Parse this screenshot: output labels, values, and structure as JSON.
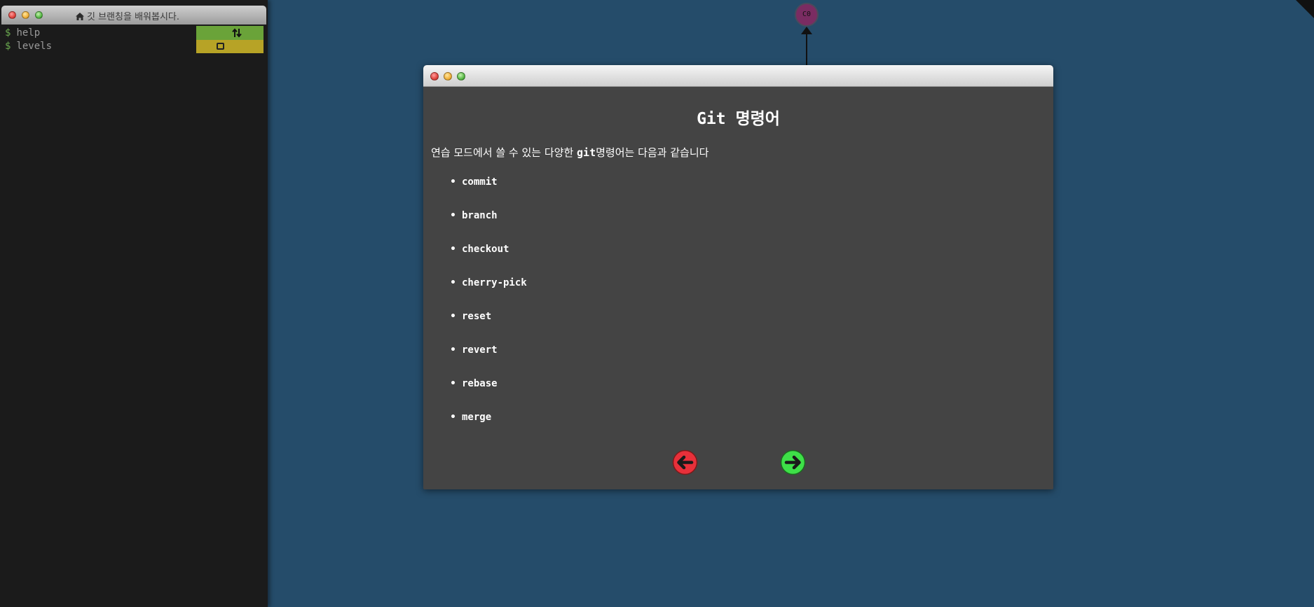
{
  "terminal": {
    "title": "깃 브랜칭을 배워봅시다.",
    "home_icon": "home-icon",
    "lines": [
      {
        "prompt": "$",
        "text": "help"
      },
      {
        "prompt": "$",
        "text": "levels"
      }
    ],
    "undo_icon": "swap-arrows-icon",
    "levels_icon": "square-icon",
    "undo_color": "#6aa339",
    "levels_color": "#b7a326"
  },
  "graph": {
    "node_label": "C0",
    "node_color": "#7a2c62"
  },
  "dialog": {
    "heading": "Git 명령어",
    "intro_before": "연습 모드에서 쓸 수 있는 다양한 ",
    "intro_code": "git",
    "intro_after": "명령어는 다음과 같습니다",
    "commands": [
      "commit",
      "branch",
      "checkout",
      "cherry-pick",
      "reset",
      "revert",
      "rebase",
      "merge"
    ],
    "prev_icon": "arrow-left-icon",
    "next_icon": "arrow-right-icon",
    "prev_color": "#e8303a",
    "next_color": "#3ee048"
  }
}
